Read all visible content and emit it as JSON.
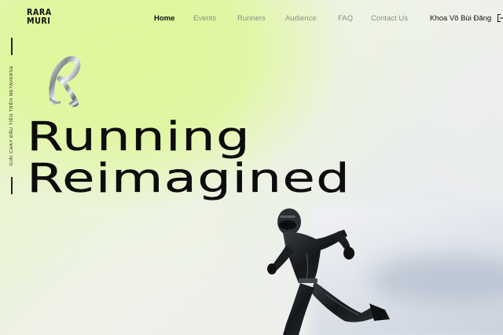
{
  "brand": {
    "logo_line1": "RARA",
    "logo_line2": "MURI"
  },
  "nav": {
    "items": [
      {
        "label": "Home",
        "active": true
      },
      {
        "label": "Events",
        "active": false
      },
      {
        "label": "Runners",
        "active": false
      },
      {
        "label": "Audience",
        "active": false
      },
      {
        "label": "FAQ",
        "active": false
      },
      {
        "label": "Contact Us",
        "active": false
      }
    ],
    "user_name": "Khoa Võ Bùi Đăng",
    "logout_icon": "logout-icon"
  },
  "hero": {
    "side_tagline": "GIẢI CHẠY ĐẦU TIÊN TRÊN METAVERSE",
    "headline_line1": "Running",
    "headline_line2": "Reimagined",
    "decor_icon": "chrome-letter-r",
    "figure": "runner-figure"
  },
  "colors": {
    "accent_green": "#dff79a",
    "text_dark": "#111111",
    "nav_muted": "#8a8f84"
  }
}
